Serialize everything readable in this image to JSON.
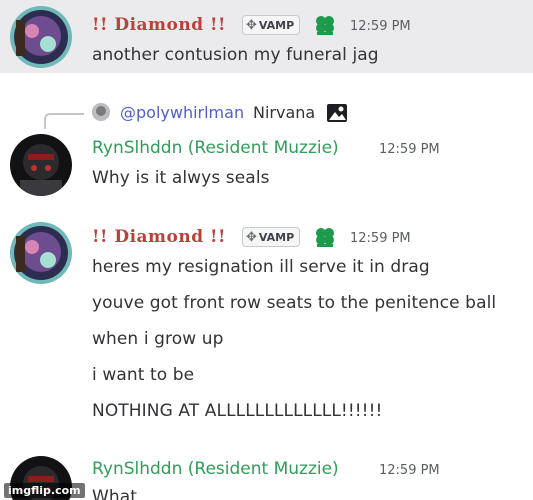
{
  "messages": [
    {
      "author": "!! Diamond !!",
      "tag": "VAMP",
      "time": "12:59 PM",
      "lines": [
        "another contusion my funeral jag"
      ]
    },
    {
      "reply": {
        "mention": "@polywhirlman",
        "text": "Nirvana"
      },
      "author": "RynSlhddn (Resident Muzzie)",
      "time": "12:59 PM",
      "lines": [
        "Why is it alwys seals"
      ]
    },
    {
      "author": "!! Diamond !!",
      "tag": "VAMP",
      "time": "12:59 PM",
      "lines": [
        "heres my resignation ill serve it in drag",
        "youve got front row seats to the penitence ball",
        "when i grow up",
        "i want to be",
        "NOTHING AT ALLLLLLLLLLLLL!!!!!!"
      ]
    },
    {
      "author": "RynSlhddn (Resident Muzzie)",
      "time": "12:59 PM",
      "lines": [
        "What"
      ]
    }
  ],
  "watermark": "imgflip.com",
  "colors": {
    "diamond": "#b8423a",
    "ryn": "#2f9e58",
    "mention": "#4f60c9",
    "highlight": "#ebebed"
  }
}
